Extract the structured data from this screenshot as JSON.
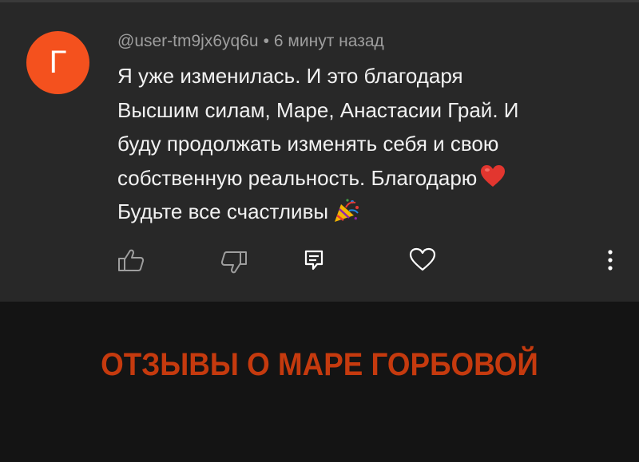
{
  "comment": {
    "avatar_letter": "Г",
    "avatar_color": "#f4511e",
    "username": "@user-tm9jx6yq6u",
    "separator": "•",
    "time_ago": "6 минут назад",
    "text_lines": [
      "Я уже изменилась. И это благодаря",
      "Высшим силам, Маре, Анастасии Грай. И",
      "буду продолжать изменять себя и свою",
      "собственную  реальность. Благодарю",
      "Будьте все счастливы"
    ],
    "emoji": [
      "red-heart",
      "party-popper"
    ],
    "actions": [
      "like",
      "dislike",
      "reply",
      "heart",
      "more"
    ]
  },
  "promo": {
    "title": "ОТЗЫВЫ О МАРЕ ГОРБОВОЙ",
    "title_color": "#c53a0e"
  }
}
